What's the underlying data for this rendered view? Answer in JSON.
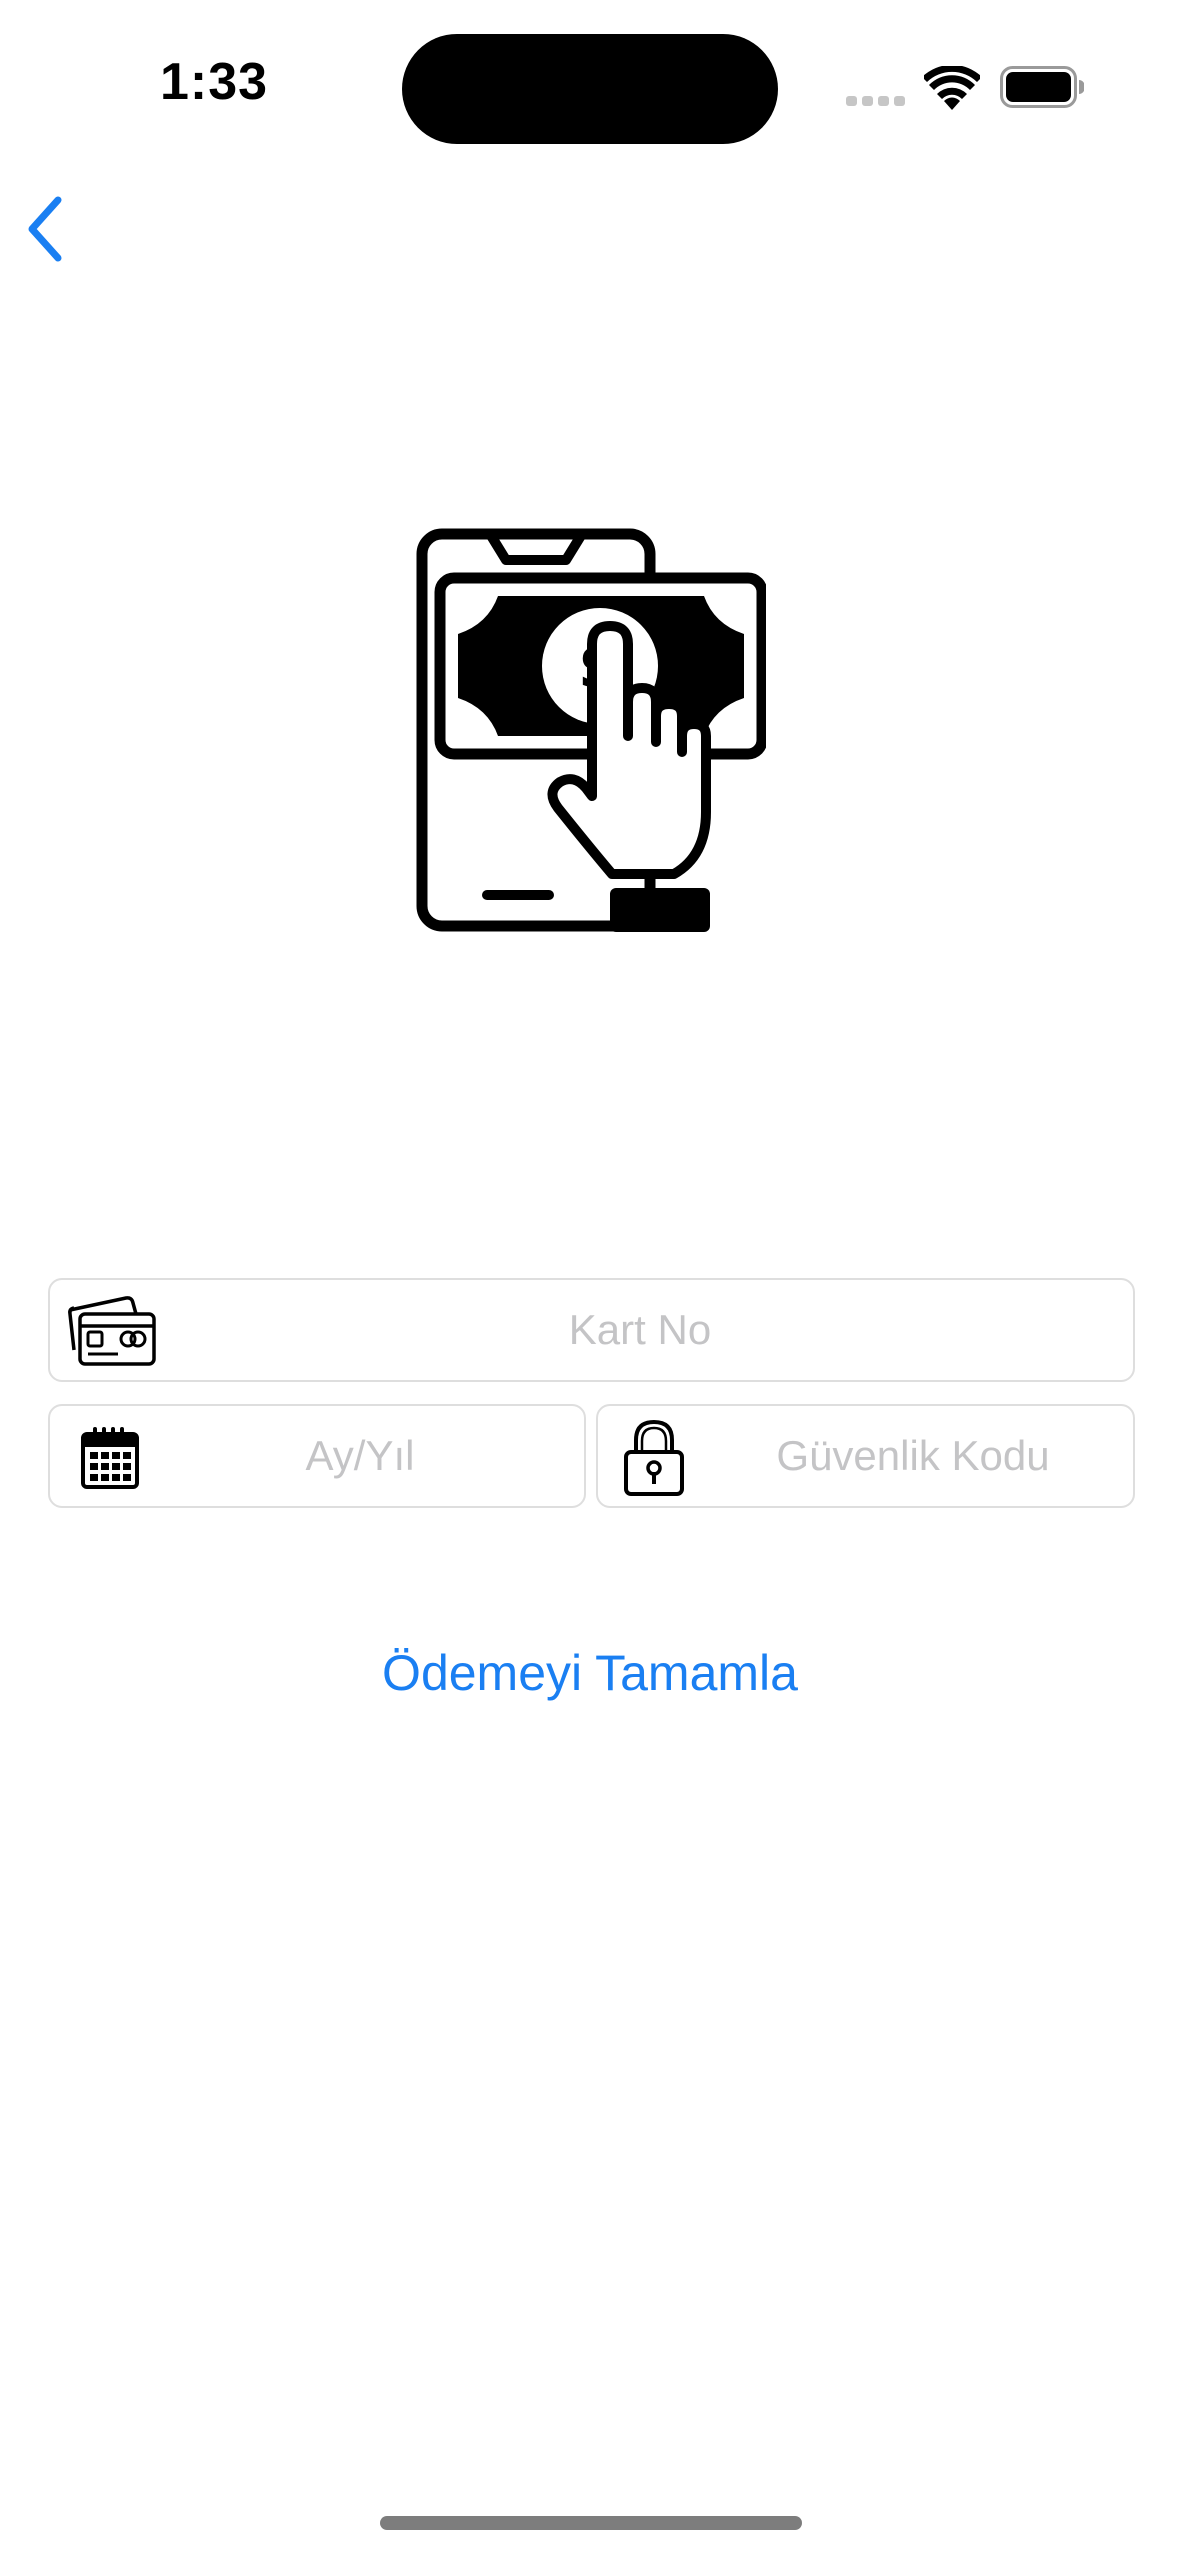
{
  "status_bar": {
    "time": "1:33",
    "icons": [
      "cellular-signal-icon",
      "wifi-icon",
      "battery-icon"
    ]
  },
  "nav": {
    "back_icon": "chevron-left-icon"
  },
  "hero": {
    "icon": "mobile-payment-icon"
  },
  "form": {
    "card_number": {
      "placeholder": "Kart No",
      "value": "",
      "icon": "credit-card-icon"
    },
    "expiry": {
      "placeholder": "Ay/Yıl",
      "value": "",
      "icon": "calendar-icon"
    },
    "security_code": {
      "placeholder": "Güvenlik Kodu",
      "value": "",
      "icon": "padlock-icon"
    }
  },
  "actions": {
    "complete_label": "Ödemeyi Tamamla"
  },
  "colors": {
    "accent": "#1a7ff2",
    "placeholder": "#c4c4c6",
    "field_border": "#dedede",
    "background": "#ffffff"
  }
}
